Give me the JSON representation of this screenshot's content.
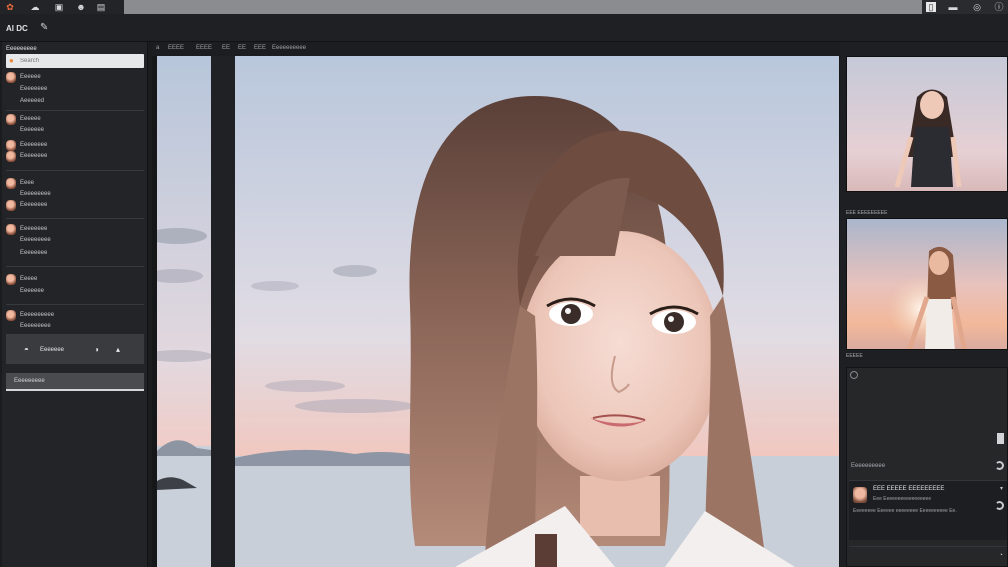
{
  "topbar": {
    "icons": [
      "app-logo-icon",
      "cloud-icon",
      "layers-icon",
      "people-icon",
      "image-icon"
    ],
    "right_icons": [
      "document-icon",
      "chat-icon",
      "settings-icon",
      "info-icon"
    ]
  },
  "toolbar": {
    "app_label": "Al DC",
    "brush_icon": "brush-icon"
  },
  "left_panel": {
    "header": "Eeeeeeeee",
    "search_placeholder": "Search",
    "items_a": [
      "Eeeeee",
      "Eeeeeeee",
      "Aeeeeed"
    ],
    "items_b": [
      "Eeeeee",
      "Eeeeeee",
      "Eeeeeeee",
      "Eeeeeeee"
    ],
    "items_c": [
      "Eeee",
      "Eeeeeeeee",
      "Eeeeeeee"
    ],
    "items_d": [
      "Eeeeeeee",
      "Eeeeeeeee",
      "Eeeeeeee"
    ],
    "items_e": [
      "Eeeee",
      "Eeeeeee"
    ],
    "items_f": [
      "Eeeeeeeeee",
      "Eeeeeeeee"
    ],
    "active_label": "Eeeeeee",
    "selected_label": "Eeeeeeeee"
  },
  "breadcrumbs": [
    "a",
    "EEEE",
    "EEEE",
    "EE",
    "EE",
    "EEE",
    "Eeeeeeeeee"
  ],
  "right_panel": {
    "caption_1": "EEE EEEEEEEEE",
    "caption_2": "EEEEE",
    "progress_label": "Eeeeeeeeee",
    "card": {
      "title": "EEE EEEEE EEEEEEEEE",
      "subtitle": "Eee Eeeeeeeeeeeeeeeee",
      "body": "Eeeeeeee Eeeeee eeeeeeee Eeeeeeeeee Ee."
    }
  },
  "colors": {
    "accent": "#ef8a3b",
    "sky_top": "#b9c7dc",
    "sky_bottom": "#f0c8c0",
    "sea": "#c8cfd8"
  }
}
